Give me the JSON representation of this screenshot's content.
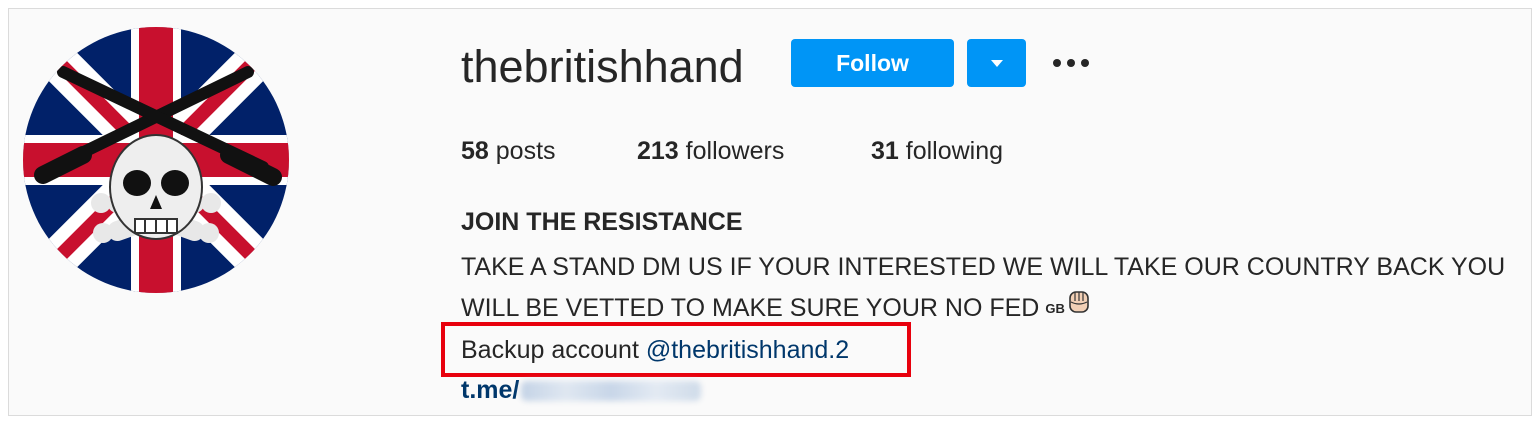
{
  "profile": {
    "username": "thebritishhand",
    "follow_label": "Follow"
  },
  "stats": {
    "posts_count": "58",
    "posts_label": "posts",
    "followers_count": "213",
    "followers_label": "followers",
    "following_count": "31",
    "following_label": "following"
  },
  "bio": {
    "name": "JOIN THE RESISTANCE",
    "line1": "TAKE A STAND DM US IF YOUR INTERESTED WE WILL TAKE OUR COUNTRY BACK YOU",
    "line2": "WILL BE VETTED TO MAKE SURE YOUR NO FED",
    "flag_text": "GB",
    "backup_prefix": "Backup account ",
    "backup_mention": "@thebritishhand.2",
    "link_prefix": "t.me/"
  },
  "colors": {
    "accent_blue": "#0095f6",
    "link_blue": "#00376b",
    "highlight_red": "#e8000d",
    "text": "#262626",
    "background": "#fafafa"
  },
  "icons": {
    "dropdown": "chevron-down-icon",
    "more": "more-options-icon",
    "fist": "raised-fist-emoji"
  }
}
